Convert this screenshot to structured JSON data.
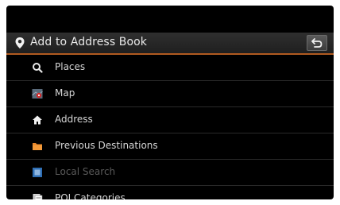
{
  "header": {
    "title": "Add to Address Book",
    "pin_icon": "location-pin-icon",
    "back_icon": "back-arrow-icon"
  },
  "menu": {
    "items": [
      {
        "label": "Places",
        "icon": "magnifier-icon",
        "enabled": true
      },
      {
        "label": "Map",
        "icon": "map-icon",
        "enabled": true
      },
      {
        "label": "Address",
        "icon": "house-icon",
        "enabled": true
      },
      {
        "label": "Previous Destinations",
        "icon": "folder-icon",
        "enabled": true
      },
      {
        "label": "Local Search",
        "icon": "local-search-icon",
        "enabled": false
      },
      {
        "label": "POI Categories",
        "icon": "poi-icon",
        "enabled": true
      }
    ]
  },
  "colors": {
    "accent_line": "#b05a20",
    "background": "#000000",
    "text": "#d6d6d6",
    "disabled_text": "#5a5a5a"
  }
}
